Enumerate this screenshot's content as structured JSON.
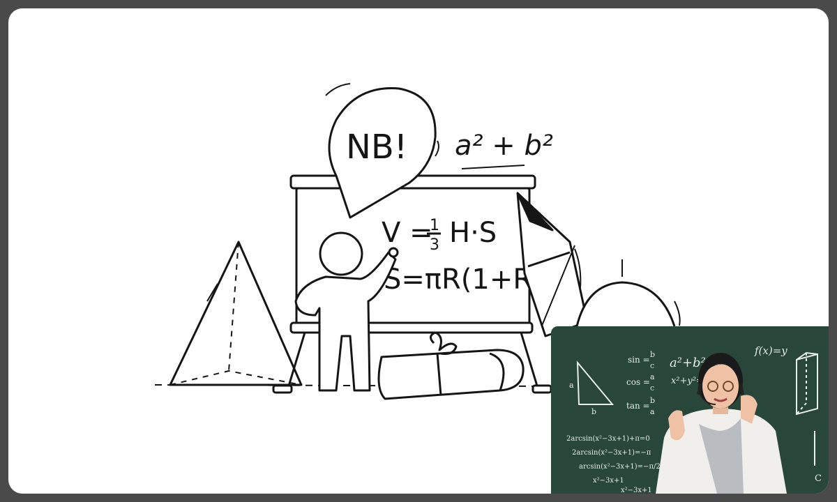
{
  "slide": {
    "note_label": "NB!",
    "formula_top": "a² + b²",
    "formula_volume_left": "V =",
    "formula_volume_num": "1",
    "formula_volume_den": "3",
    "formula_volume_right": "H·S",
    "formula_surface": "S=πR(1+R)"
  },
  "video": {
    "chalk": {
      "sin_label": "sin =",
      "sin_num": "b",
      "sin_den": "c",
      "cos_label": "cos =",
      "cos_num": "a",
      "cos_den": "c",
      "tan_label": "tan =",
      "tan_num": "b",
      "tan_den": "a",
      "top_formula": "a²+b²=c²",
      "mid_formula": "x²+y²=z²",
      "fn_formula": "f(x)=y",
      "eq1": "2arcsin(x²−3x+1)+π=0",
      "eq2": "2arcsin(x²−3x+1)=−π",
      "eq3": "arcsin(x²−3x+1)=−π/2",
      "eq4": "x²−3x+1",
      "eq5": "x²−3x+1",
      "side_c": "C",
      "tri_a": "a",
      "tri_b": "b"
    }
  }
}
